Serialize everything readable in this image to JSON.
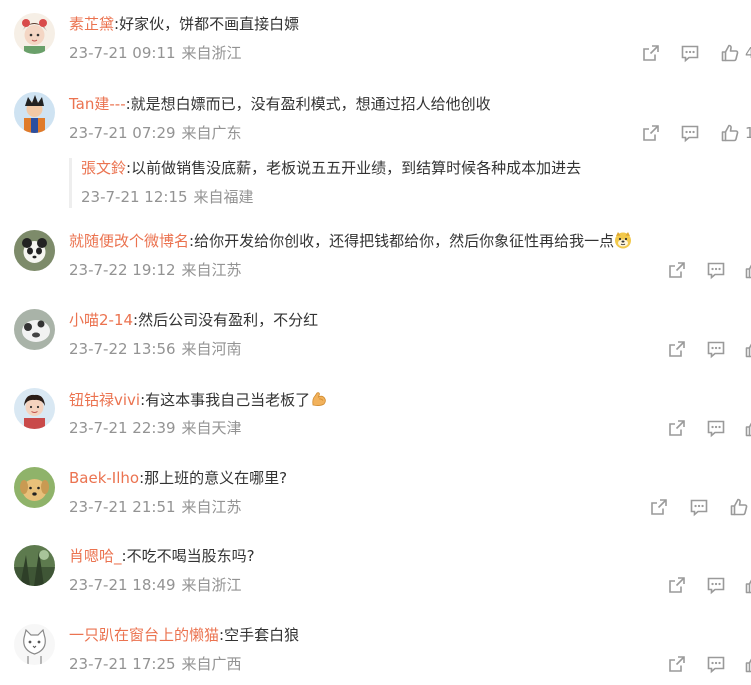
{
  "comments": [
    {
      "user": "素芷黛",
      "text": ":好家伙，饼都不画直接白嫖",
      "date": "23-7-21 09:11",
      "location": "来自浙江",
      "like_count_partial": "4"
    },
    {
      "user": "Tan建---",
      "text": ":就是想白嫖而已，没有盈利模式，想通过招人给他创收",
      "date": "23-7-21 07:29",
      "location": "来自广东",
      "like_count_partial": "1",
      "reply": {
        "user": "張文鈴",
        "text": ":以前做销售没底薪，老板说五五开业绩，到结算时候各种成本加进去",
        "date": "23-7-21 12:15",
        "location": "来自福建"
      }
    },
    {
      "user": "就随便改个微博名",
      "text": ":给你开发给你创收，还得把钱都给你，然后你象征性再给我一点",
      "date": "23-7-22 19:12",
      "location": "来自江苏",
      "emoji": "doge-icon"
    },
    {
      "user": "小喵2-14",
      "text": ":然后公司没有盈利，不分红",
      "date": "23-7-22 13:56",
      "location": "来自河南"
    },
    {
      "user": "钮钴禄vivi",
      "text": ":有这本事我自己当老板了",
      "date": "23-7-21 22:39",
      "location": "来自天津",
      "emoji": "muscle-icon"
    },
    {
      "user": "Baek-Ilho",
      "text": ":那上班的意义在哪里?",
      "date": "23-7-21 21:51",
      "location": "来自江苏"
    },
    {
      "user": "肖嗯哈_",
      "text": ":不吃不喝当股东吗?",
      "date": "23-7-21 18:49",
      "location": "来自浙江"
    },
    {
      "user": "一只趴在窗台上的懒猫",
      "text": ":空手套白狼",
      "date": "23-7-21 17:25",
      "location": "来自广西"
    }
  ],
  "colors": {
    "username": "#eb7350",
    "text": "#333333",
    "meta": "#939393",
    "icon": "#9a9a9a"
  },
  "icons": {
    "share": "share-icon",
    "comment": "comment-icon",
    "like": "like-icon"
  }
}
